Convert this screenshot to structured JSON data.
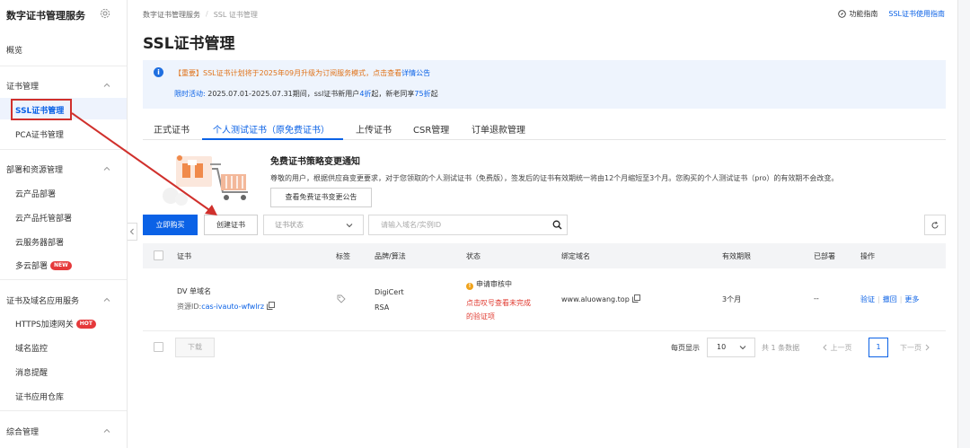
{
  "sidebar": {
    "title": "数字证书管理服务",
    "overview": "概览",
    "groups": [
      {
        "label": "证书管理",
        "items": [
          "SSL证书管理",
          "PCA证书管理"
        ]
      },
      {
        "label": "部署和资源管理",
        "items": [
          "云产品部署",
          "云产品托管部署",
          "云服务器部署",
          "多云部署"
        ]
      },
      {
        "label": "证书及域名应用服务",
        "items": [
          "HTTPS加速网关",
          "域名监控",
          "消息提醒",
          "证书应用仓库"
        ]
      },
      {
        "label": "综合管理",
        "items": []
      }
    ],
    "badges": {
      "new": "NEW",
      "hot": "HOT"
    }
  },
  "breadcrumb": {
    "root": "数字证书管理服务",
    "sep": "/",
    "current": "SSL 证书管理"
  },
  "top_links": {
    "guide": "功能指南",
    "usage": "SSL证书使用指南"
  },
  "page_title": "SSL证书管理",
  "notice": {
    "line1_text": "【重要】SSL证书计划将于2025年09月升级为订阅服务模式，点击查看",
    "line1_link": "详情公告",
    "line2_label": "限时活动:",
    "line2_a": " 2025.07.01-2025.07.31期间，ssl证书新用户",
    "line2_b": "4折",
    "line2_c": "起，新老同享",
    "line2_d": "75折",
    "line2_e": "起"
  },
  "tabs": [
    "正式证书",
    "个人测试证书（原免费证书）",
    "上传证书",
    "CSR管理",
    "订单退款管理"
  ],
  "active_tab": 1,
  "promo": {
    "title": "免费证书策略变更通知",
    "desc": "尊敬的用户，根据供应商变更要求，对于您领取的个人测试证书（免费版），签发后的证书有效期统一将由12个月缩短至3个月。您购买的个人测试证书（pro）的有效期不会改变。",
    "button": "查看免费证书变更公告"
  },
  "toolbar": {
    "buy": "立即购买",
    "create": "创建证书",
    "status_placeholder": "证书状态",
    "search_placeholder": "请输入域名/实例ID"
  },
  "table": {
    "headers": [
      "证书",
      "标签",
      "品牌/算法",
      "状态",
      "绑定域名",
      "有效期限",
      "已部署",
      "操作"
    ],
    "rows": [
      {
        "name": "DV 单域名",
        "resource_label": "资源ID:",
        "resource_id": "cas-ivauto-wfwlrz",
        "brand": "DigiCert",
        "algo": "RSA",
        "status": "申请审核中",
        "status_hint_1": "点击叹号查看未完成",
        "status_hint_2": "的验证项",
        "domain": "www.aluowang.top",
        "validity": "3个月",
        "deployed": "--",
        "actions": [
          "验证",
          "撤回",
          "更多"
        ]
      }
    ]
  },
  "footer": {
    "download": "下载",
    "page_size_label": "每页显示",
    "page_size": "10",
    "total": "共 1 条数据",
    "prev": "上一页",
    "current_page": "1",
    "next": "下一页"
  },
  "colors": {
    "accent": "#0b62e6",
    "annotation": "#d0302c",
    "warning": "#f0a31c"
  }
}
